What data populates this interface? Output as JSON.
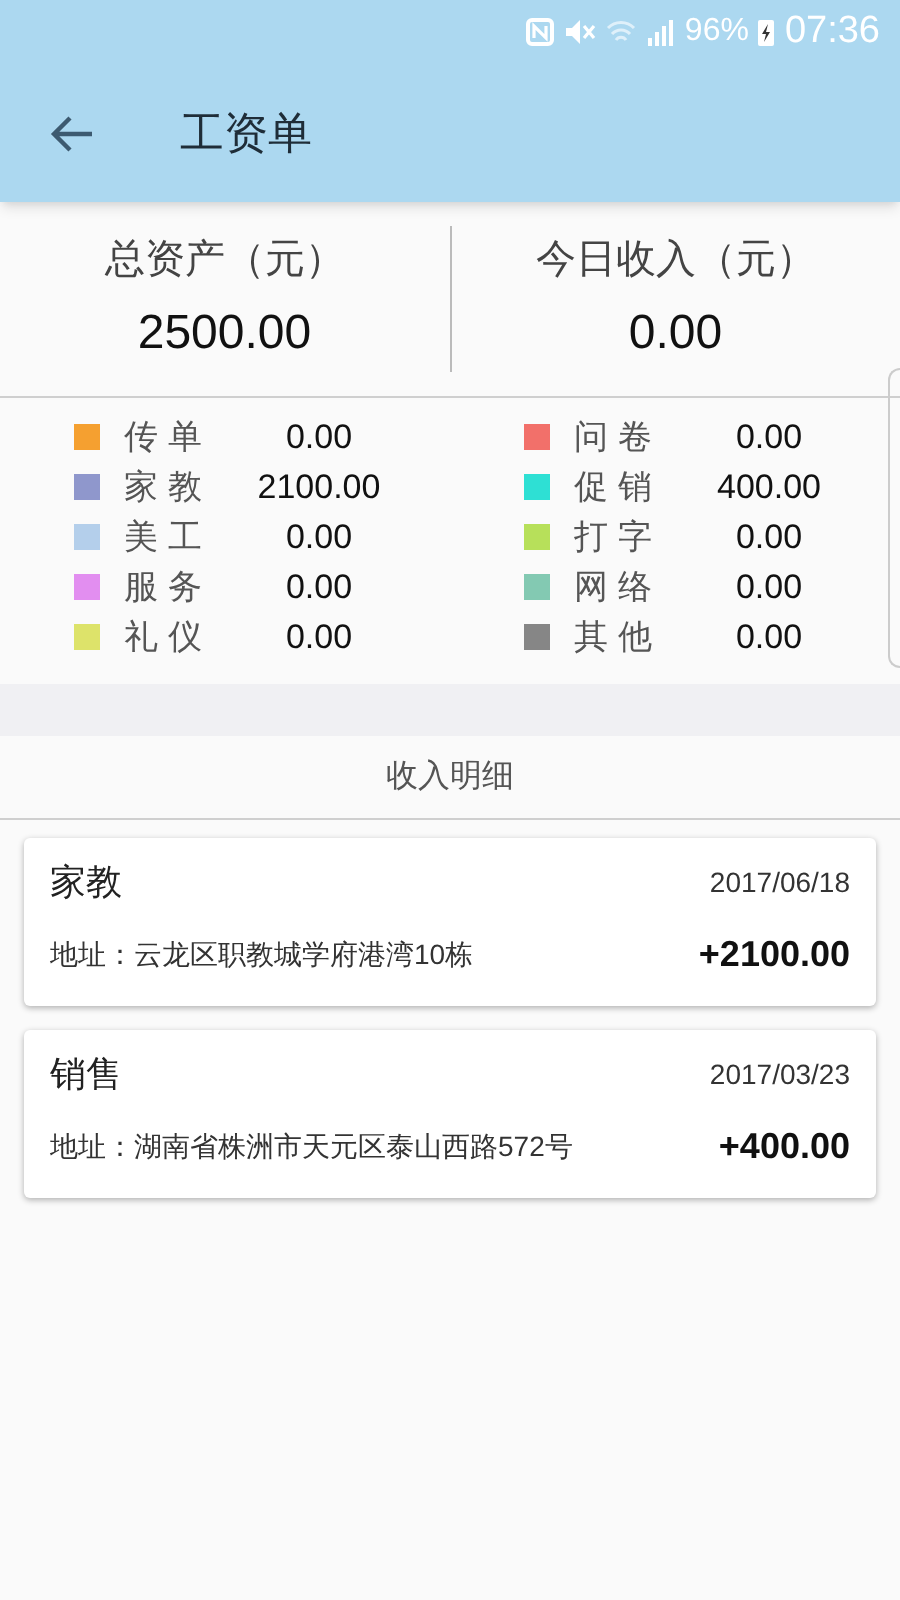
{
  "status_bar": {
    "battery": "96%",
    "time": "07:36"
  },
  "app_bar": {
    "title": "工资单"
  },
  "summary": [
    {
      "label": "总资产（元）",
      "value": "2500.00"
    },
    {
      "label": "今日收入（元）",
      "value": "0.00"
    }
  ],
  "categories": [
    {
      "name": "传单",
      "amount": "0.00",
      "color": "#f5a030"
    },
    {
      "name": "问卷",
      "amount": "0.00",
      "color": "#f2706a"
    },
    {
      "name": "家教",
      "amount": "2100.00",
      "color": "#8f97cc"
    },
    {
      "name": "促销",
      "amount": "400.00",
      "color": "#2ee0d4"
    },
    {
      "name": "美工",
      "amount": "0.00",
      "color": "#b4cfeb"
    },
    {
      "name": "打字",
      "amount": "0.00",
      "color": "#b7e05a"
    },
    {
      "name": "服务",
      "amount": "0.00",
      "color": "#e28ef0"
    },
    {
      "name": "网络",
      "amount": "0.00",
      "color": "#83c9b2"
    },
    {
      "name": "礼仪",
      "amount": "0.00",
      "color": "#dde36a"
    },
    {
      "name": "其他",
      "amount": "0.00",
      "color": "#868686"
    }
  ],
  "details_header": "收入明细",
  "records": [
    {
      "title": "家教",
      "date": "2017/06/18",
      "address": "地址：云龙区职教城学府港湾10栋",
      "amount": "+2100.00"
    },
    {
      "title": "销售",
      "date": "2017/03/23",
      "address": "地址：湖南省株洲市天元区泰山西路572号",
      "amount": "+400.00"
    }
  ]
}
